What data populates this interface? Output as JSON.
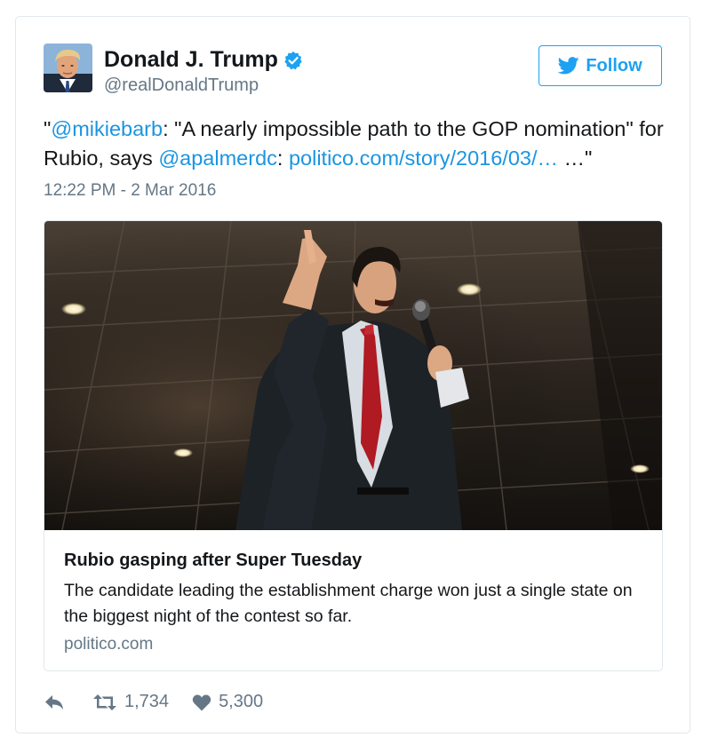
{
  "author": {
    "name": "Donald J. Trump",
    "handle": "@realDonaldTrump",
    "verified": true,
    "avatar_icon": "profile-photo"
  },
  "follow_button": {
    "label": "Follow",
    "icon": "twitter-bird-icon",
    "color": "#1da1f2"
  },
  "tweet": {
    "open_quote": "\"",
    "mention1": "@mikiebarb",
    "text1": ": \"A nearly impossible path to the GOP nomination\" for Rubio, says ",
    "mention2": "@apalmerdc",
    "text2": ": ",
    "link": "politico.com/story/2016/03/…",
    "text3": " …\"",
    "timestamp": "12:22 PM - 2 Mar 2016",
    "link_color": "#1b95e0"
  },
  "card": {
    "image_alt": "Photo of Marco Rubio speaking into a microphone in a dim hall",
    "title": "Rubio gasping after Super Tuesday",
    "description": "The candidate leading the establishment charge won just a single state on the biggest night of the contest so far.",
    "domain": "politico.com"
  },
  "actions": {
    "reply_icon": "reply-icon",
    "retweet_icon": "retweet-icon",
    "retweet_count": "1,734",
    "like_icon": "heart-icon",
    "like_count": "5,300"
  }
}
